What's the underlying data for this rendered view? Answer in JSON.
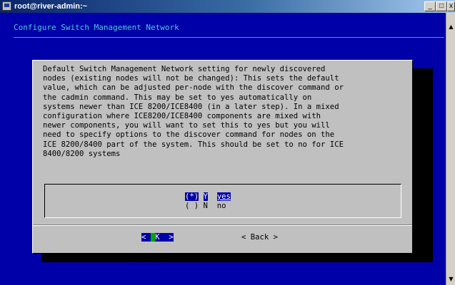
{
  "window": {
    "title": "root@river-admin:~",
    "minimize_label": "_",
    "maximize_label": "□",
    "close_label": "x"
  },
  "terminal": {
    "header": "Configure Switch Management Network"
  },
  "dialog": {
    "body_lines": [
      "Default Switch Management Network setting for newly discovered",
      "nodes (existing nodes will not be changed): This sets the default",
      "value, which can be adjusted per-node with the discover command or",
      "the cadmin command. This may be set to yes automatically on",
      "systems newer than ICE 8200/ICE8400 (in a later step). In a mixed",
      "configuration where ICE8200/ICE8400 components are mixed with",
      "newer components, you will want to set this to yes but you will",
      "need to specify options to the discover command for nodes on the",
      "ICE 8200/8400 part of the system. This should be set to no for ICE",
      "8400/8200 systems"
    ],
    "options": [
      {
        "radio": "(*)",
        "key": "Y",
        "value": "yes",
        "selected": true
      },
      {
        "radio": "( )",
        "key": "N",
        "value": "no",
        "selected": false
      }
    ],
    "ok_button": {
      "left": "<",
      "hot": " ",
      "rest": "K",
      "right": ">"
    },
    "back_button": "< Back >"
  },
  "scrollbar": {
    "up_icon": "▲",
    "down_icon": "▼"
  },
  "colors": {
    "terminal_bg": "#0000a8",
    "dialog_bg": "#c0c0c0",
    "header_text": "#4ec9dc",
    "ok_hot": "#00a800"
  }
}
